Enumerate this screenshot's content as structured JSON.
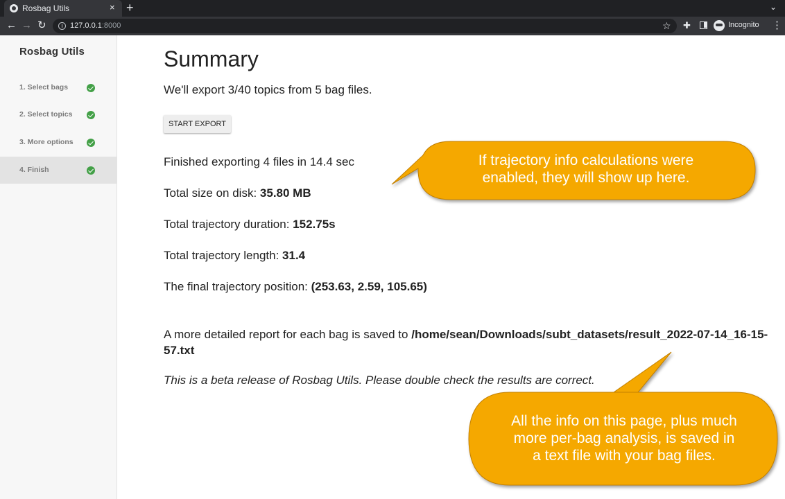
{
  "browser": {
    "tab_title": "Rosbag Utils",
    "tab_close": "×",
    "new_tab": "+",
    "tab_menu": "⌄",
    "url_host": "127.0.0.1",
    "url_port": ":8000",
    "incognito_label": "Incognito"
  },
  "sidebar": {
    "title": "Rosbag Utils",
    "steps": [
      {
        "label": "1. Select bags",
        "complete": true
      },
      {
        "label": "2. Select topics",
        "complete": true
      },
      {
        "label": "3. More options",
        "complete": true
      },
      {
        "label": "4. Finish",
        "complete": true,
        "active": true
      }
    ]
  },
  "main": {
    "heading": "Summary",
    "subtitle": "We'll export 3/40 topics from 5 bag files.",
    "export_button": "START EXPORT",
    "finished": "Finished exporting 4 files in 14.4 sec",
    "size_label": "Total size on disk: ",
    "size_value": "35.80 MB",
    "duration_label": "Total trajectory duration: ",
    "duration_value": "152.75s",
    "length_label": "Total trajectory length: ",
    "length_value": "31.4",
    "position_label": "The final trajectory position: ",
    "position_value": "(253.63, 2.59, 105.65)",
    "report_label": "A more detailed report for each bag is saved to ",
    "report_path": "/home/sean/Downloads/subt_datasets/result_2022-07-14_16-15-57.txt",
    "beta_note": "This is a beta release of Rosbag Utils. Please double check the results are correct."
  },
  "callouts": {
    "top_line1": "If trajectory info calculations were",
    "top_line2": "enabled, they will show up here.",
    "bottom_line1": "All the info on this page, plus much",
    "bottom_line2": "more per-bag analysis, is saved in",
    "bottom_line3": "a text file with your bag files.",
    "color": "#f5a800"
  }
}
